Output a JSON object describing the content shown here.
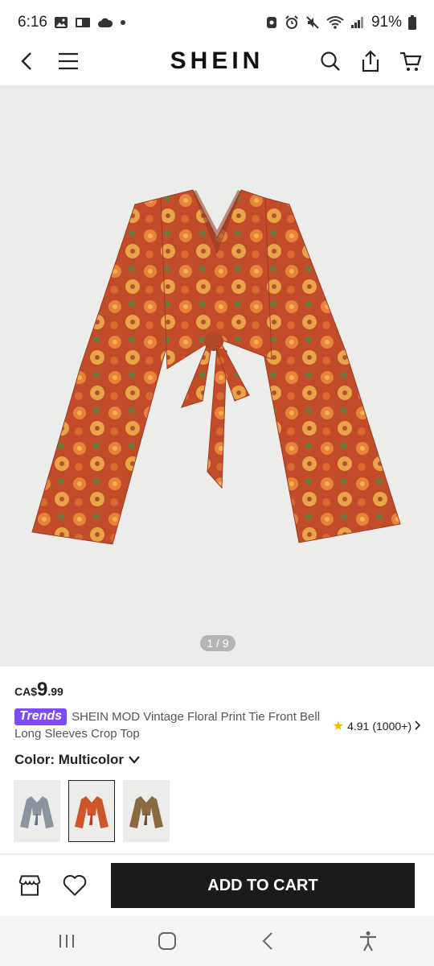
{
  "status_bar": {
    "time": "6:16",
    "battery": "91%"
  },
  "header": {
    "brand": "SHEIN"
  },
  "hero": {
    "counter": "1 / 9"
  },
  "product": {
    "price_currency": "CA$",
    "price_whole": "9",
    "price_cents": ".99",
    "badge": "Trends",
    "title": "SHEIN MOD Vintage Floral Print Tie Front Bell Long Sleeves Crop Top",
    "rating": "4.91",
    "review_count": "(1000+)"
  },
  "color": {
    "label": "Color: Multicolor",
    "swatches": [
      {
        "name": "Gray floral",
        "selected": false
      },
      {
        "name": "Multicolor",
        "selected": true
      },
      {
        "name": "Brown floral",
        "selected": false
      }
    ]
  },
  "bottom_bar": {
    "add_to_cart": "ADD TO CART"
  },
  "colors": {
    "primary": "#1b1b1b",
    "badge": "#7b4cf0",
    "star": "#f5b400",
    "garment": "#c8552f"
  },
  "icons": [
    "back-icon",
    "menu-icon",
    "search-icon",
    "share-icon",
    "cart-icon",
    "store-icon",
    "heart-icon",
    "recent-apps-icon",
    "home-icon",
    "nav-back-icon",
    "accessibility-icon"
  ]
}
